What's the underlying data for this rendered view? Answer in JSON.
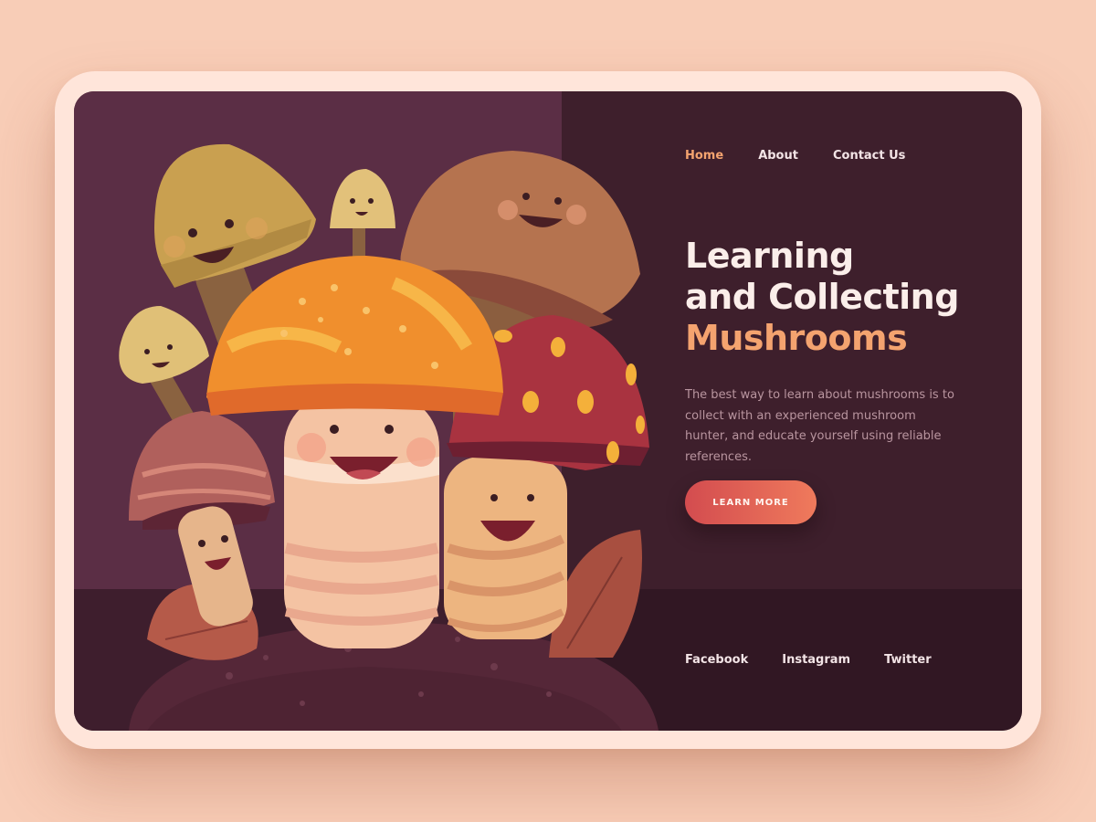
{
  "nav": {
    "items": [
      {
        "label": "Home",
        "active": true
      },
      {
        "label": "About",
        "active": false
      },
      {
        "label": "Contact Us",
        "active": false
      }
    ]
  },
  "hero": {
    "title_line1": "Learning",
    "title_line2": "and Collecting",
    "title_accent": "Mushrooms",
    "description": "The best way to learn about mushrooms is to collect with an experienced mushroom hunter, and educate yourself using reliable references.",
    "cta_label": "LEARN MORE"
  },
  "social": {
    "facebook": "Facebook",
    "instagram": "Instagram",
    "twitter": "Twitter"
  },
  "colors": {
    "accent": "#f4a36f",
    "background": "#f8cdb7",
    "panel_dark": "#3e1f2c",
    "panel_plum": "#5b2e45",
    "cta_start": "#d34c4f",
    "cta_end": "#ef7a5c"
  },
  "illustration": {
    "icon": "mushroom-family-illustration"
  }
}
